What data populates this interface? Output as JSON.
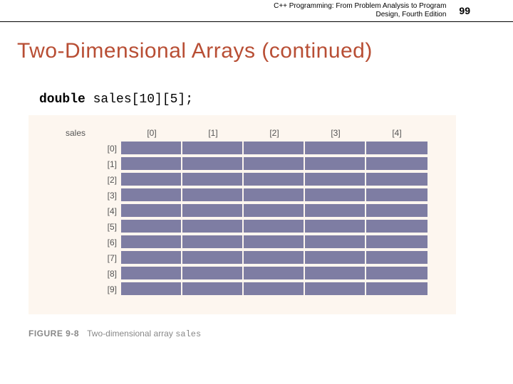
{
  "header": {
    "book_title_line1": "C++ Programming: From Problem Analysis to Program",
    "book_title_line2": "Design, Fourth Edition",
    "page_number": "99"
  },
  "heading": "Two-Dimensional Arrays (continued)",
  "code": {
    "keyword": "double",
    "rest": " sales[10][5];"
  },
  "array": {
    "name": "sales",
    "col_headers": [
      "[0]",
      "[1]",
      "[2]",
      "[3]",
      "[4]"
    ],
    "row_headers": [
      "[0]",
      "[1]",
      "[2]",
      "[3]",
      "[4]",
      "[5]",
      "[6]",
      "[7]",
      "[8]",
      "[9]"
    ]
  },
  "figure_caption": {
    "label": "FIGURE 9-8",
    "text_prefix": "Two-dimensional array ",
    "code_word": "sales"
  }
}
